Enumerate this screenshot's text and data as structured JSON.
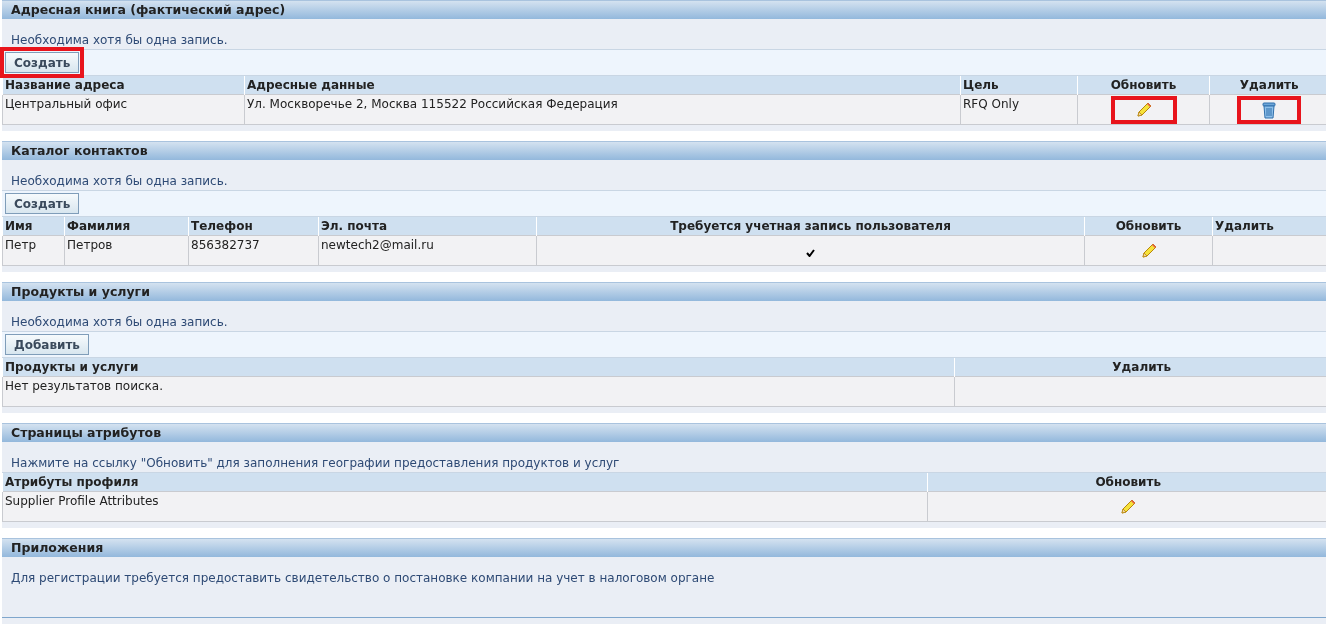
{
  "sections": [
    {
      "title": "Адресная книга (фактический адрес)",
      "note": "Необходима хотя бы одна запись.",
      "button": {
        "label": "Создать",
        "highlighted": true
      },
      "columns": [
        {
          "label": "Название адреса"
        },
        {
          "label": "Адресные данные"
        },
        {
          "label": "Цель"
        },
        {
          "label": "Обновить"
        },
        {
          "label": "Удалить"
        }
      ],
      "rows": [
        [
          {
            "kind": "text",
            "text": "Центральный офис"
          },
          {
            "kind": "text",
            "text": "Ул. Москворечье 2, Москва 115522 Российская Федерация"
          },
          {
            "kind": "text",
            "text": "RFQ Only"
          },
          {
            "kind": "edit",
            "highlighted": true
          },
          {
            "kind": "delete",
            "highlighted": true
          }
        ]
      ]
    },
    {
      "title": "Каталог контактов",
      "note": "Необходима хотя бы одна запись.",
      "button": {
        "label": "Создать",
        "highlighted": false
      },
      "columns": [
        {
          "label": "Имя"
        },
        {
          "label": "Фамилия"
        },
        {
          "label": "Телефон"
        },
        {
          "label": "Эл. почта"
        },
        {
          "label": "Требуется учетная запись пользователя"
        },
        {
          "label": "Обновить"
        },
        {
          "label": "Удалить"
        }
      ],
      "rows": [
        [
          {
            "kind": "text",
            "text": "Петр"
          },
          {
            "kind": "text",
            "text": "Петров"
          },
          {
            "kind": "text",
            "text": "856382737"
          },
          {
            "kind": "text",
            "text": "newtech2@mail.ru"
          },
          {
            "kind": "check",
            "checked": true
          },
          {
            "kind": "edit",
            "highlighted": false
          },
          {
            "kind": "empty"
          }
        ]
      ]
    },
    {
      "title": "Продукты и услуги",
      "note": "Необходима хотя бы одна запись.",
      "button": {
        "label": "Добавить",
        "highlighted": false
      },
      "columns": [
        {
          "label": "Продукты и услуги"
        },
        {
          "label": "Удалить"
        }
      ],
      "rows": [
        [
          {
            "kind": "text",
            "text": "Нет результатов поиска."
          },
          {
            "kind": "empty"
          }
        ]
      ]
    },
    {
      "title": "Страницы атрибутов",
      "note": "Нажмите на ссылку \"Обновить\" для заполнения географии предоставления продуктов и услуг",
      "columns": [
        {
          "label": "Атрибуты профиля"
        },
        {
          "label": "Обновить"
        }
      ],
      "rows": [
        [
          {
            "kind": "text",
            "text": "Supplier Profile Attributes"
          },
          {
            "kind": "edit",
            "highlighted": false
          }
        ]
      ]
    },
    {
      "title": "Приложения",
      "note": "Для регистрации требуется предоставить свидетельство о постановке компании на учет в налоговом органе"
    }
  ]
}
